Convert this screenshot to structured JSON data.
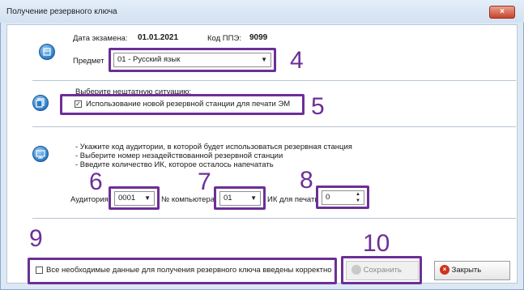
{
  "window": {
    "title": "Получение резервного ключа",
    "close_symbol": "×"
  },
  "exam": {
    "date_label": "Дата экзамена:",
    "date_value": "01.01.2021",
    "ppe_label": "Код ППЭ:",
    "ppe_value": "9099"
  },
  "subject": {
    "label": "Предмет",
    "selected": "01 - Русский язык"
  },
  "situation": {
    "prompt": "Выберите нештатную ситуацию:",
    "checkbox_label": "Использование новой резервной станции для печати ЭМ",
    "checked": true
  },
  "instructions": [
    "- Укажите код аудитории, в которой будет использоваться резервная станция",
    "- Выберите номер незадействованной резервной станции",
    "- Введите количество ИК, которое осталось напечатать"
  ],
  "fields": {
    "auditorium_label": "Аудитория",
    "auditorium_value": "0001",
    "computer_label": "№ компьютера",
    "computer_value": "01",
    "ik_label": "ИК для печати",
    "ik_value": "0"
  },
  "confirm": {
    "label": "Все необходимые данные для получения резервного ключа введены корректно",
    "checked": false
  },
  "buttons": {
    "save_label": "Сохранить",
    "close_label": "Закрыть",
    "save_enabled": false
  },
  "callouts": [
    "4",
    "5",
    "6",
    "7",
    "8",
    "9",
    "10"
  ],
  "colors": {
    "callout": "#6c2f96",
    "icon_blue": "#2a7cc8",
    "close_red": "#c8442a"
  }
}
